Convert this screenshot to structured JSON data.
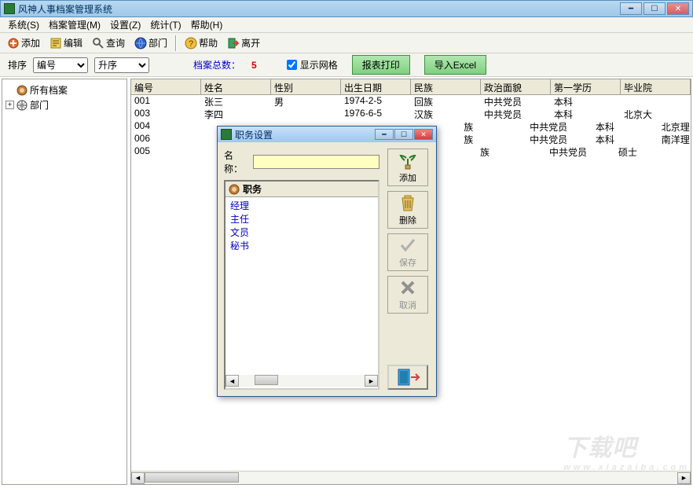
{
  "window": {
    "title": "风神人事档案管理系统",
    "min_glyph": "━",
    "max_glyph": "☐",
    "close_glyph": "✕"
  },
  "menu": {
    "system": "系统(S)",
    "archive": "档案管理(M)",
    "settings": "设置(Z)",
    "stats": "统计(T)",
    "help": "帮助(H)"
  },
  "toolbar": {
    "add": "添加",
    "edit": "编辑",
    "query": "查询",
    "dept": "部门",
    "help": "帮助",
    "leave": "离开"
  },
  "filter": {
    "sort_label": "排序",
    "sort_field": "编号",
    "sort_dir": "升序",
    "total_label": "档案总数：",
    "total_value": "5",
    "show_grid": "显示网格",
    "print_btn": "报表打印",
    "export_btn": "导入Excel"
  },
  "tree": {
    "all": "所有档案",
    "dept": "部门",
    "expand": "+"
  },
  "grid": {
    "headers": [
      "编号",
      "姓名",
      "性别",
      "出生日期",
      "民族",
      "政治面貌",
      "第一学历",
      "毕业院"
    ],
    "widths": [
      90,
      90,
      90,
      90,
      90,
      90,
      90,
      90
    ],
    "rows": [
      {
        "cells": [
          "001",
          "张三",
          "男",
          "1974-2-5",
          "回族",
          "中共党员",
          "本科",
          ""
        ]
      },
      {
        "cells": [
          "003",
          "李四",
          "",
          "1976-6-5",
          "汉族",
          "中共党员",
          "本科",
          "北京大"
        ]
      },
      {
        "cells": [
          "004",
          "",
          "",
          "",
          "",
          "族",
          "中共党员",
          "本科",
          "北京理"
        ]
      },
      {
        "cells": [
          "006",
          "",
          "",
          "",
          "",
          "族",
          "中共党员",
          "本科",
          "南洋理"
        ]
      },
      {
        "cells": [
          "005",
          "",
          "",
          "",
          "",
          "族",
          "中共党员",
          "硕士",
          ""
        ]
      }
    ]
  },
  "dialog": {
    "title": "职务设置",
    "name_label": "名称：",
    "name_value": "",
    "list_header": "职务",
    "items": [
      "经理",
      "主任",
      "文员",
      "秘书"
    ],
    "add": "添加",
    "delete": "删除",
    "save": "保存",
    "cancel": "取消"
  },
  "watermark": {
    "big": "下载吧",
    "small": "www.xiazaiba.com"
  }
}
